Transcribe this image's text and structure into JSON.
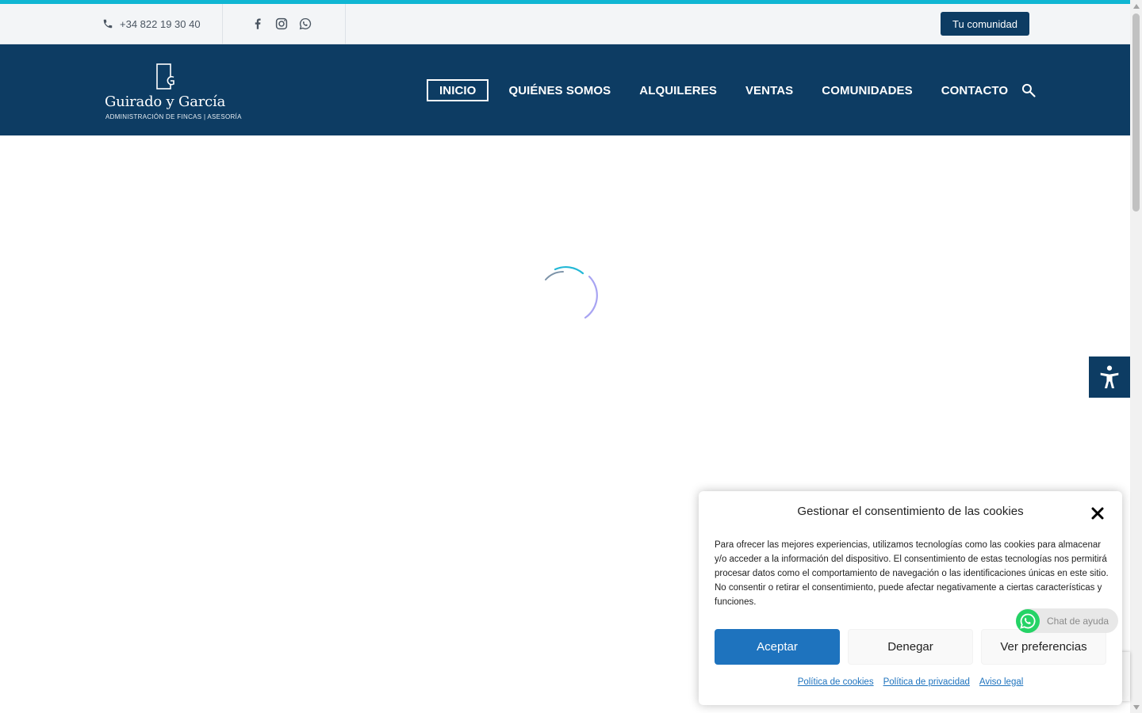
{
  "topbar": {
    "phone": "+34 822 19 30 40",
    "social_icons": [
      "facebook-icon",
      "instagram-icon",
      "whatsapp-icon"
    ],
    "cta_label": "Tu comunidad"
  },
  "brand": {
    "name": "Guirado y García",
    "tagline": "ADMINISTRACIÓN DE FINCAS | ASESORÍA"
  },
  "nav": {
    "items": [
      {
        "label": "INICIO",
        "active": true
      },
      {
        "label": "QUIÉNES SOMOS",
        "active": false
      },
      {
        "label": "ALQUILERES",
        "active": false
      },
      {
        "label": "VENTAS",
        "active": false
      },
      {
        "label": "COMUNIDADES",
        "active": false
      },
      {
        "label": "CONTACTO",
        "active": false
      }
    ]
  },
  "cookie_banner": {
    "title": "Gestionar el consentimiento de las cookies",
    "body": "Para ofrecer las mejores experiencias, utilizamos tecnologías como las cookies para almacenar y/o acceder a la información del dispositivo. El consentimiento de estas tecnologías nos permitirá procesar datos como el comportamiento de navegación o las identificaciones únicas en este sitio. No consentir o retirar el consentimiento, puede afectar negativamente a ciertas características y funciones.",
    "accept_label": "Aceptar",
    "deny_label": "Denegar",
    "prefs_label": "Ver preferencias",
    "links": [
      "Política de cookies",
      "Política de privacidad",
      "Aviso legal"
    ]
  },
  "chat": {
    "label": "Chat de ayuda"
  },
  "colors": {
    "accent_strip": "#0fb6d3",
    "brand_navy": "#0d3c63",
    "cookie_accept": "#1e73be",
    "whatsapp_green": "#25d366"
  }
}
